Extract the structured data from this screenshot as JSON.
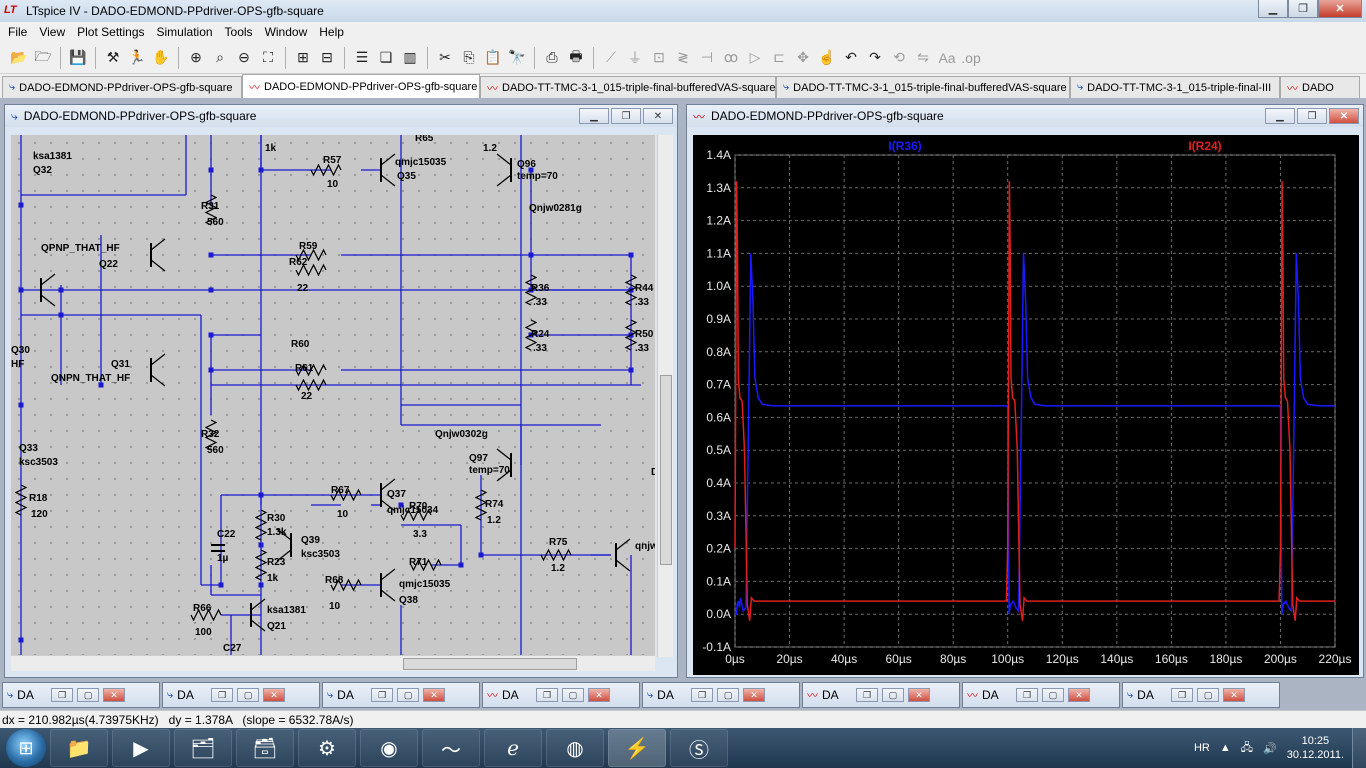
{
  "window": {
    "title": "LTspice IV - DADO-EDMOND-PPdriver-OPS-gfb-square",
    "logo": "LT"
  },
  "menu": [
    "File",
    "View",
    "Plot Settings",
    "Simulation",
    "Tools",
    "Window",
    "Help"
  ],
  "tabs": [
    {
      "label": "DADO-EDMOND-PPdriver-OPS-gfb-square",
      "kind": "schematic"
    },
    {
      "label": "DADO-EDMOND-PPdriver-OPS-gfb-square",
      "kind": "plot",
      "active": true
    },
    {
      "label": "DADO-TT-TMC-3-1_015-triple-final-bufferedVAS-square",
      "kind": "plot"
    },
    {
      "label": "DADO-TT-TMC-3-1_015-triple-final-bufferedVAS-square",
      "kind": "schematic"
    },
    {
      "label": "DADO-TT-TMC-3-1_015-triple-final-III",
      "kind": "schematic"
    },
    {
      "label": "DADO",
      "kind": "plot"
    }
  ],
  "schematic_window": {
    "title": "DADO-EDMOND-PPdriver-OPS-gfb-square",
    "labels": [
      {
        "t": "ksa1381",
        "k": "a1"
      },
      {
        "t": "Q32",
        "k": "a2"
      },
      {
        "t": "1k",
        "k": "a3"
      },
      {
        "t": "R57",
        "k": "a4"
      },
      {
        "t": "10",
        "k": "a5"
      },
      {
        "t": "R65",
        "k": "a6"
      },
      {
        "t": "qmjc15035",
        "k": "a7"
      },
      {
        "t": "Q35",
        "k": "a8"
      },
      {
        "t": "1.2",
        "k": "a9"
      },
      {
        "t": "Q96",
        "k": "a10"
      },
      {
        "t": "temp=70",
        "k": "a11"
      },
      {
        "t": "Qnjw0281g",
        "k": "a12"
      },
      {
        "t": "R31",
        "k": "a13"
      },
      {
        "t": "560",
        "k": "a14"
      },
      {
        "t": "QPNP_THAT_HF",
        "k": "a15"
      },
      {
        "t": "Q22",
        "k": "a16"
      },
      {
        "t": "R59",
        "k": "a17"
      },
      {
        "t": "R62",
        "k": "a18"
      },
      {
        "t": "22",
        "k": "a19"
      },
      {
        "t": "R36",
        "k": "a20"
      },
      {
        "t": ".33",
        "k": "a21"
      },
      {
        "t": "R44",
        "k": "a22"
      },
      {
        "t": ".33",
        "k": "a23"
      },
      {
        "t": "R24",
        "k": "a24"
      },
      {
        "t": ".33",
        "k": "a25"
      },
      {
        "t": "R50",
        "k": "a26"
      },
      {
        "t": ".33",
        "k": "a27"
      },
      {
        "t": "R60",
        "k": "a28"
      },
      {
        "t": "R61",
        "k": "a29"
      },
      {
        "t": "22",
        "k": "a30"
      },
      {
        "t": "QNPN_THAT_HF",
        "k": "a31"
      },
      {
        "t": "Q31",
        "k": "a32"
      },
      {
        "t": "Q30",
        "k": "a33"
      },
      {
        "t": "HF",
        "k": "a34"
      },
      {
        "t": "Q33",
        "k": "a35"
      },
      {
        "t": "ksc3503",
        "k": "a36"
      },
      {
        "t": "R32",
        "k": "a37"
      },
      {
        "t": "560",
        "k": "a38"
      },
      {
        "t": "Qnjw0302g",
        "k": "a39"
      },
      {
        "t": "Q97",
        "k": "a40"
      },
      {
        "t": "temp=70",
        "k": "a41"
      },
      {
        "t": "R18",
        "k": "a42"
      },
      {
        "t": "120",
        "k": "a43"
      },
      {
        "t": "R67",
        "k": "a44"
      },
      {
        "t": "10",
        "k": "a45"
      },
      {
        "t": "Q37",
        "k": "a46"
      },
      {
        "t": "qmjc15034",
        "k": "a47"
      },
      {
        "t": "R70",
        "k": "a48"
      },
      {
        "t": "3.3",
        "k": "a49"
      },
      {
        "t": "R74",
        "k": "a50"
      },
      {
        "t": "1.2",
        "k": "a51"
      },
      {
        "t": "R30",
        "k": "a52"
      },
      {
        "t": "1.3k",
        "k": "a53"
      },
      {
        "t": "Q39",
        "k": "a54"
      },
      {
        "t": "ksc3503",
        "k": "a55"
      },
      {
        "t": "C22",
        "k": "a56"
      },
      {
        "t": "1µ",
        "k": "a57"
      },
      {
        "t": "R23",
        "k": "a58"
      },
      {
        "t": "1k",
        "k": "a59"
      },
      {
        "t": "R71",
        "k": "a60"
      },
      {
        "t": "qmjc15035",
        "k": "a61"
      },
      {
        "t": "Q38",
        "k": "a62"
      },
      {
        "t": "R75",
        "k": "a63"
      },
      {
        "t": "1.2",
        "k": "a64"
      },
      {
        "t": "R68",
        "k": "a65"
      },
      {
        "t": "10",
        "k": "a66"
      },
      {
        "t": "R66",
        "k": "a67"
      },
      {
        "t": "100",
        "k": "a68"
      },
      {
        "t": "ksa1381",
        "k": "a69"
      },
      {
        "t": "Q21",
        "k": "a70"
      },
      {
        "t": "C27",
        "k": "a71"
      },
      {
        "t": "qnjw",
        "k": "a72"
      },
      {
        "t": "D",
        "k": "a73"
      }
    ]
  },
  "plot_window": {
    "title": "DADO-EDMOND-PPdriver-OPS-gfb-square"
  },
  "chart_data": {
    "type": "line",
    "title": "",
    "xlabel": "",
    "ylabel": "",
    "xlim": [
      0,
      220
    ],
    "ylim": [
      -0.1,
      1.4
    ],
    "x_ticks": [
      "0µs",
      "20µs",
      "40µs",
      "60µs",
      "80µs",
      "100µs",
      "120µs",
      "140µs",
      "160µs",
      "180µs",
      "200µs",
      "220µs"
    ],
    "y_ticks": [
      "-0.1A",
      "0.0A",
      "0.1A",
      "0.2A",
      "0.3A",
      "0.4A",
      "0.5A",
      "0.6A",
      "0.7A",
      "0.8A",
      "0.9A",
      "1.0A",
      "1.1A",
      "1.2A",
      "1.3A",
      "1.4A"
    ],
    "grid": true,
    "background": "#000000",
    "series": [
      {
        "name": "I(R36)",
        "color": "#1a1aff",
        "x": [
          0,
          0.5,
          0.8,
          1.2,
          1.6,
          2.0,
          2.5,
          3.0,
          4.0,
          5.0,
          5.8,
          6.6,
          7.3,
          8.5,
          10,
          14,
          20,
          40,
          60,
          80,
          99.5,
          100,
          100.5,
          101,
          102,
          103,
          104,
          105,
          105.8,
          106.6,
          107.3,
          108.5,
          110,
          114,
          120,
          140,
          160,
          180,
          199.5,
          200,
          200.5,
          201,
          202,
          203,
          204,
          205,
          205.8,
          206.6,
          207.3,
          208.5,
          210,
          214,
          220
        ],
        "y": [
          0.0,
          0.0,
          0.03,
          0.04,
          0.02,
          0.05,
          0.03,
          0.01,
          0.02,
          0.6,
          1.1,
          0.95,
          0.72,
          0.66,
          0.64,
          0.635,
          0.635,
          0.635,
          0.635,
          0.635,
          0.635,
          0.63,
          0.0,
          0.03,
          0.04,
          0.02,
          0.01,
          0.6,
          1.1,
          0.95,
          0.72,
          0.66,
          0.64,
          0.635,
          0.635,
          0.635,
          0.635,
          0.635,
          0.635,
          0.63,
          0.0,
          0.03,
          0.04,
          0.02,
          0.01,
          0.6,
          1.1,
          0.95,
          0.72,
          0.66,
          0.64,
          0.635,
          0.635
        ]
      },
      {
        "name": "I(R24)",
        "color": "#e0201c",
        "x": [
          0,
          0.6,
          0.9,
          1.2,
          1.8,
          2.6,
          3.5,
          4.5,
          5.4,
          6.0,
          7.0,
          9.0,
          12,
          16,
          20,
          40,
          60,
          80,
          99.5,
          100,
          100.6,
          100.9,
          101.2,
          101.8,
          102.6,
          103.5,
          104.5,
          105.4,
          106,
          107,
          109,
          112,
          116,
          120,
          140,
          160,
          180,
          199.5,
          200,
          200.6,
          200.9,
          201.2,
          201.8,
          202.6,
          203.5,
          204.5,
          205.4,
          206,
          207,
          209,
          212,
          216,
          220
        ],
        "y": [
          0.2,
          1.32,
          1.1,
          0.72,
          0.66,
          0.65,
          0.5,
          0.03,
          -0.02,
          0.05,
          0.04,
          0.04,
          0.04,
          0.04,
          0.04,
          0.04,
          0.04,
          0.04,
          0.04,
          0.2,
          1.32,
          1.1,
          0.72,
          0.66,
          0.65,
          0.5,
          0.03,
          -0.02,
          0.05,
          0.04,
          0.04,
          0.04,
          0.04,
          0.04,
          0.04,
          0.04,
          0.04,
          0.04,
          0.2,
          1.32,
          1.1,
          0.72,
          0.66,
          0.65,
          0.5,
          0.03,
          -0.02,
          0.05,
          0.04,
          0.04,
          0.04,
          0.04,
          0.04
        ]
      }
    ]
  },
  "minimized_windows": [
    {
      "label": "DA",
      "kind": "schematic"
    },
    {
      "label": "DA",
      "kind": "schematic"
    },
    {
      "label": "DA",
      "kind": "schematic"
    },
    {
      "label": "DA",
      "kind": "plot"
    },
    {
      "label": "DA",
      "kind": "schematic"
    },
    {
      "label": "DA",
      "kind": "plot"
    },
    {
      "label": "DA",
      "kind": "plot"
    },
    {
      "label": "DA",
      "kind": "schematic"
    }
  ],
  "status": {
    "text": "dx = 210.982µs(4.73975KHz)   dy = 1.378A   (slope = 6532.78A/s)"
  },
  "taskbar": {
    "lang": "HR",
    "time": "10:25",
    "date": "30.12.2011."
  }
}
